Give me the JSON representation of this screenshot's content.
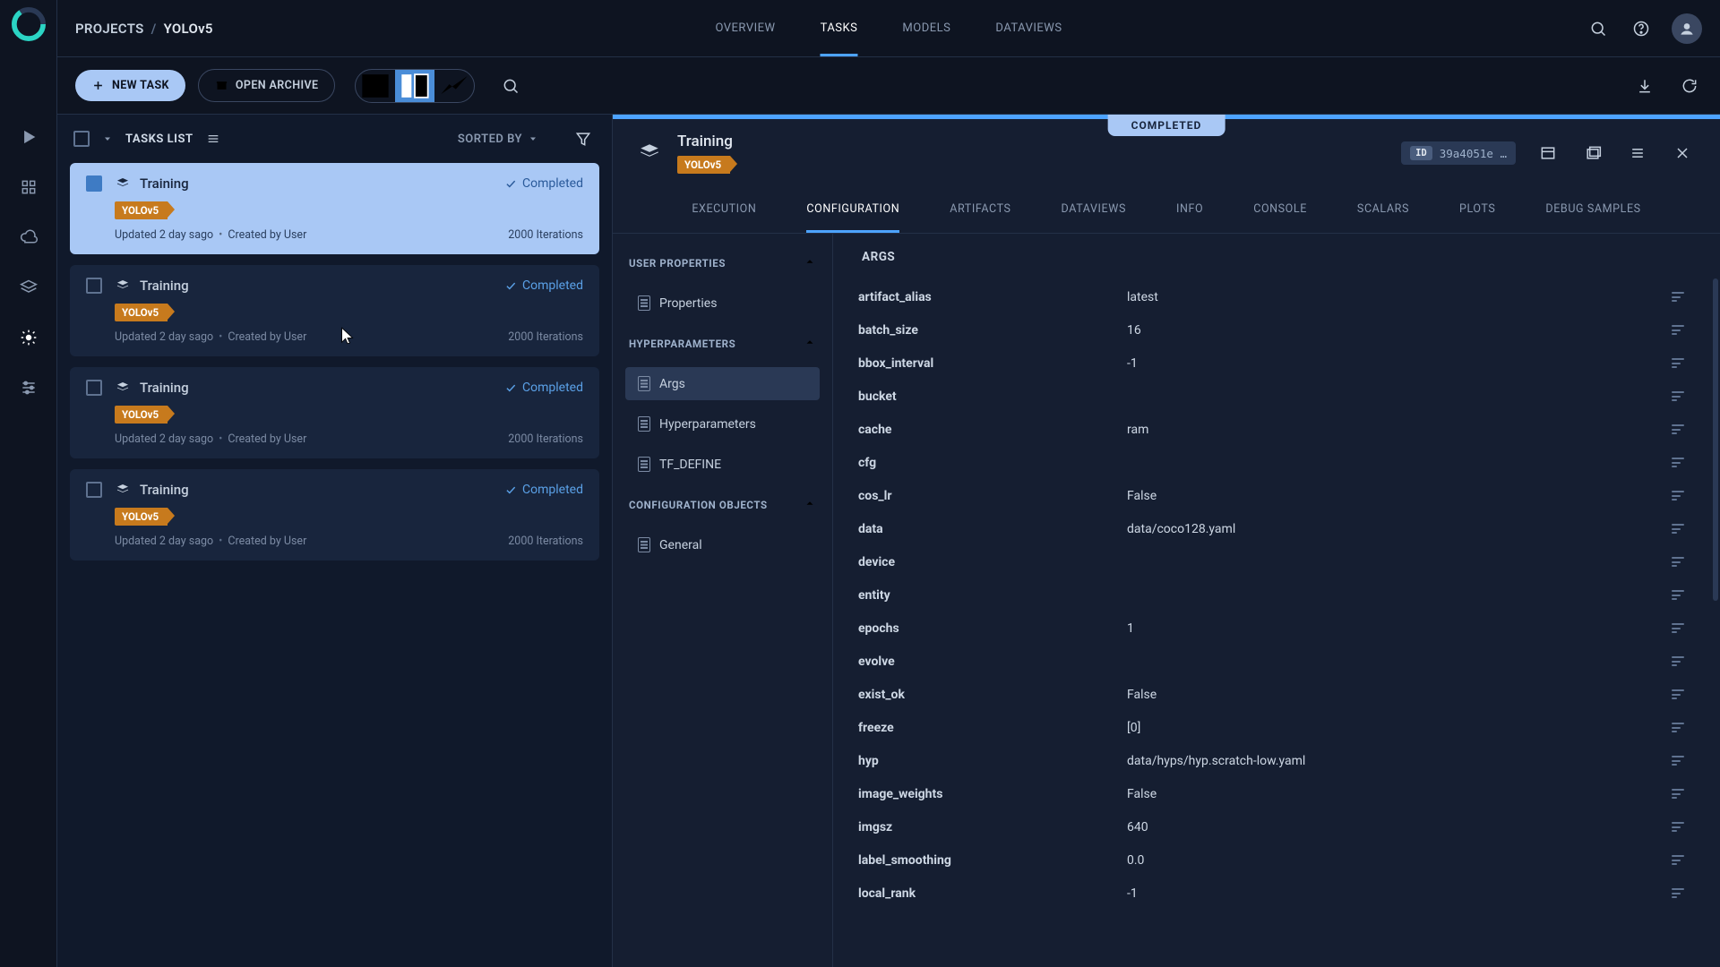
{
  "breadcrumb": {
    "projects": "PROJECTS",
    "name": "YOLOv5"
  },
  "nav": {
    "overview": "OVERVIEW",
    "tasks": "TASKS",
    "models": "MODELS",
    "dataviews": "DATAVIEWS"
  },
  "toolbar": {
    "newTask": "NEW TASK",
    "openArchive": "OPEN ARCHIVE"
  },
  "list": {
    "title": "TASKS LIST",
    "sortedBy": "SORTED BY",
    "items": [
      {
        "title": "Training",
        "status": "Completed",
        "tag": "YOLOv5",
        "updated": "Updated 2 day sago",
        "created": "Created by User",
        "iterations": "2000 Iterations"
      },
      {
        "title": "Training",
        "status": "Completed",
        "tag": "YOLOv5",
        "updated": "Updated 2 day sago",
        "created": "Created by User",
        "iterations": "2000 Iterations"
      },
      {
        "title": "Training",
        "status": "Completed",
        "tag": "YOLOv5",
        "updated": "Updated 2 day sago",
        "created": "Created by User",
        "iterations": "2000 Iterations"
      },
      {
        "title": "Training",
        "status": "Completed",
        "tag": "YOLOv5",
        "updated": "Updated 2 day sago",
        "created": "Created by User",
        "iterations": "2000 Iterations"
      }
    ]
  },
  "detail": {
    "statusChip": "COMPLETED",
    "title": "Training",
    "tag": "YOLOv5",
    "id": "39a4051e …",
    "tabs": {
      "execution": "EXECUTION",
      "configuration": "CONFIGURATION",
      "artifacts": "ARTIFACTS",
      "dataviews": "DATAVIEWS",
      "info": "INFO",
      "console": "CONSOLE",
      "scalars": "SCALARS",
      "plots": "PLOTS",
      "debug": "DEBUG SAMPLES"
    },
    "tree": {
      "userProps": "USER PROPERTIES",
      "properties": "Properties",
      "hyper": "HYPERPARAMETERS",
      "args": "Args",
      "hyperparameters": "Hyperparameters",
      "tfdefine": "TF_DEFINE",
      "confObj": "CONFIGURATION OBJECTS",
      "general": "General"
    },
    "argsHeader": "ARGS",
    "args": [
      {
        "k": "artifact_alias",
        "v": "latest"
      },
      {
        "k": "batch_size",
        "v": "16"
      },
      {
        "k": "bbox_interval",
        "v": "-1"
      },
      {
        "k": "bucket",
        "v": ""
      },
      {
        "k": "cache",
        "v": "ram"
      },
      {
        "k": "cfg",
        "v": ""
      },
      {
        "k": "cos_lr",
        "v": "False"
      },
      {
        "k": "data",
        "v": "data/coco128.yaml"
      },
      {
        "k": "device",
        "v": ""
      },
      {
        "k": "entity",
        "v": ""
      },
      {
        "k": "epochs",
        "v": "1"
      },
      {
        "k": "evolve",
        "v": ""
      },
      {
        "k": "exist_ok",
        "v": "False"
      },
      {
        "k": "freeze",
        "v": "[0]"
      },
      {
        "k": "hyp",
        "v": "data/hyps/hyp.scratch-low.yaml"
      },
      {
        "k": "image_weights",
        "v": "False"
      },
      {
        "k": "imgsz",
        "v": "640"
      },
      {
        "k": "label_smoothing",
        "v": "0.0"
      },
      {
        "k": "local_rank",
        "v": "-1"
      }
    ]
  }
}
